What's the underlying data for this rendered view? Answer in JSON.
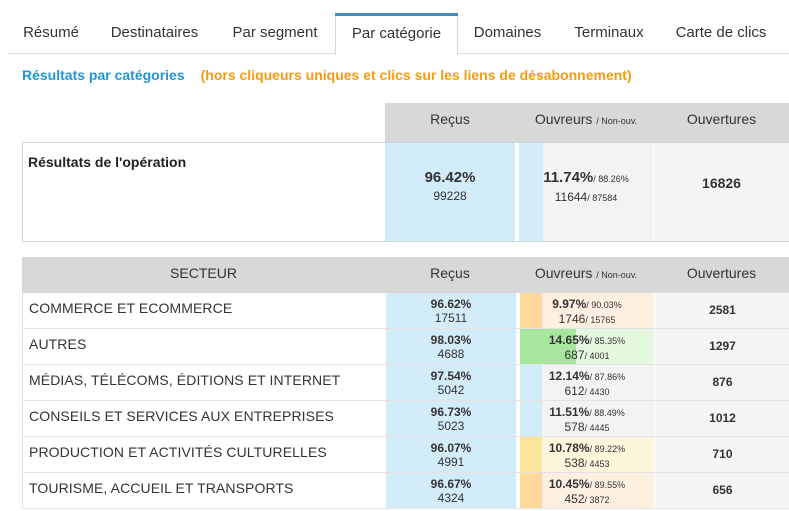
{
  "tabs": [
    {
      "label": "Résumé"
    },
    {
      "label": "Destinataires"
    },
    {
      "label": "Par segment"
    },
    {
      "label": "Par catégorie",
      "active": true
    },
    {
      "label": "Domaines"
    },
    {
      "label": "Terminaux"
    },
    {
      "label": "Carte de clics"
    }
  ],
  "subtitle": {
    "title": "Résultats par catégories",
    "note": "(hors cliqueurs uniques et clics sur les liens de désabonnement)"
  },
  "summary": {
    "headers": {
      "recus": "Reçus",
      "ouvreurs": "Ouvreurs",
      "non_ouv": "/ Non-ouv.",
      "ouvertures": "Ouvertures"
    },
    "label": "Résultats de l'opération",
    "recus_pct": "96.42%",
    "recus_num": "99228",
    "ouvreurs_pct": "11.74%",
    "non_ouv_pct": "/ 88.26%",
    "ouvreurs_num": "11644",
    "non_ouv_num": "/ 87584",
    "ouvertures": "16826"
  },
  "sector_table": {
    "headers": {
      "secteur": "SECTEUR",
      "recus": "Reçus",
      "ouvreurs": "Ouvreurs",
      "non_ouv": "/ Non-ouv.",
      "ouvertures": "Ouvertures"
    },
    "rows": [
      {
        "name": "COMMERCE ET ECOMMERCE",
        "recus_pct": "96.62%",
        "recus_num": "17511",
        "ouv_pct": "9.97%",
        "non_pct": "/ 90.03%",
        "ouv_num": "1746",
        "non_num": "/ 15765",
        "ouvertures": "2581",
        "bar_color": "#ffd99c",
        "bg_color": "#fdf0e0"
      },
      {
        "name": "AUTRES",
        "recus_pct": "98.03%",
        "recus_num": "4688",
        "ouv_pct": "14.65%",
        "non_pct": "/ 85.35%",
        "ouv_num": "687",
        "non_num": "/ 4001",
        "ouvertures": "1297",
        "bar_color": "#a8e6a0",
        "bg_color": "#e3f8df"
      },
      {
        "name": "MÉDIAS, TÉLÉCOMS, ÉDITIONS ET INTERNET",
        "recus_pct": "97.54%",
        "recus_num": "5042",
        "ouv_pct": "12.14%",
        "non_pct": "/ 87.86%",
        "ouv_num": "612",
        "non_num": "/ 4430",
        "ouvertures": "876",
        "bar_color": "#d3ecfa",
        "bg_color": "#f3f3f3"
      },
      {
        "name": "CONSEILS ET SERVICES AUX ENTREPRISES",
        "recus_pct": "96.73%",
        "recus_num": "5023",
        "ouv_pct": "11.51%",
        "non_pct": "/ 88.49%",
        "ouv_num": "578",
        "non_num": "/ 4445",
        "ouvertures": "1012",
        "bar_color": "#d3ecfa",
        "bg_color": "#f3f3f3"
      },
      {
        "name": "PRODUCTION ET ACTIVITÉS CULTURELLES",
        "recus_pct": "96.07%",
        "recus_num": "4991",
        "ouv_pct": "10.78%",
        "non_pct": "/ 89.22%",
        "ouv_num": "538",
        "non_num": "/ 4453",
        "ouvertures": "710",
        "bar_color": "#fbe59a",
        "bg_color": "#fdf6dc"
      },
      {
        "name": "TOURISME, ACCUEIL ET TRANSPORTS",
        "recus_pct": "96.67%",
        "recus_num": "4324",
        "ouv_pct": "10.45%",
        "non_pct": "/ 89.55%",
        "ouv_num": "452",
        "non_num": "/ 3872",
        "ouvertures": "656",
        "bar_color": "#ffd99c",
        "bg_color": "#fdf0e0"
      }
    ]
  },
  "colors": {
    "accent_blue": "#2196d3",
    "accent_orange": "#f39c12",
    "tab_active_bar": "#3c8dbc"
  }
}
